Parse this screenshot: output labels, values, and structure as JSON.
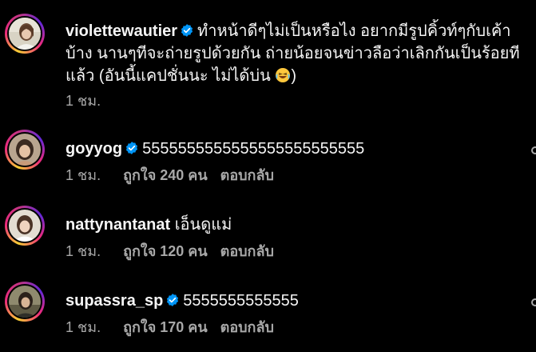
{
  "caption": {
    "username": "violettewautier",
    "text_line1": "ทำหน้าดีๆไม่เป็นหรือไง อยากมีรูปคิ้วท์ๆกับเค้า",
    "text_line2": "บ้าง นานๆทีจะถ่ายรูปด้วยกัน ถ่ายน้อยจนข่าวลือว่าเลิกกันเป็นร้อยที",
    "text_line3": "แล้ว (อันนี้แคปชั่นนะ ไม่ได้บ่น",
    "text_line3_end": ")",
    "emoji": "laughing-face-emoji",
    "time": "1 ชม."
  },
  "comments": [
    {
      "username": "goyyog",
      "verified": true,
      "text": "5555555555555555555555555",
      "time": "1 ชม.",
      "likes": "ถูกใจ 240 คน",
      "reply": "ตอบกลับ"
    },
    {
      "username": "nattynantanat",
      "verified": false,
      "text": "เอ็นดูแม่",
      "time": "1 ชม.",
      "likes": "ถูกใจ 120 คน",
      "reply": "ตอบกลับ"
    },
    {
      "username": "supassra_sp",
      "verified": true,
      "text": "5555555555555",
      "time": "1 ชม.",
      "likes": "ถูกใจ 170 คน",
      "reply": "ตอบกลับ"
    }
  ],
  "colors": {
    "background": "#000000",
    "text": "#f5f5f5",
    "secondary": "#a8a8a8",
    "verified": "#0095f6"
  }
}
